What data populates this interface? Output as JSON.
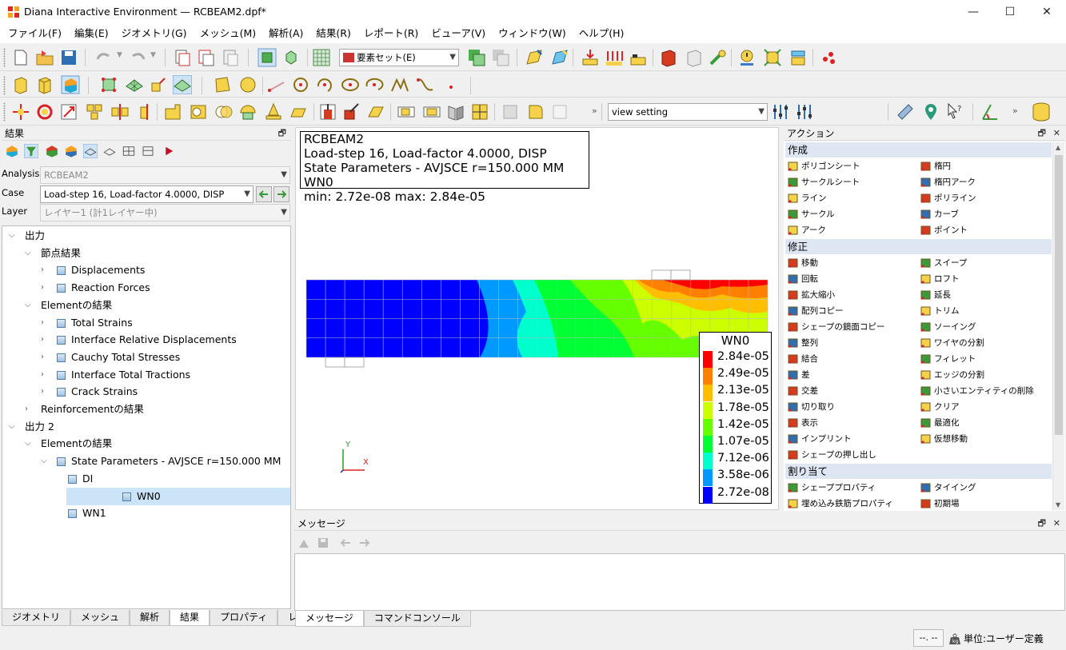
{
  "window": {
    "title": "Diana Interactive Environment — RCBEAM2.dpf*",
    "minimize": "—",
    "maximize": "☐",
    "close": "✕"
  },
  "menu": [
    "ファイル(F)",
    "編集(E)",
    "ジオメトリ(G)",
    "メッシュ(M)",
    "解析(A)",
    "結果(R)",
    "レポート(R)",
    "ビューア(V)",
    "ウィンドウ(W)",
    "ヘルプ(H)"
  ],
  "toolbar": {
    "element_set": "要素セット(E)",
    "view_setting": "view setting",
    "overflow": "»"
  },
  "results_panel": {
    "title": "結果",
    "analysis_label": "Analysis",
    "analysis_value": "RCBEAM2",
    "case_label": "Case",
    "case_value": "Load-step 16, Load-factor 4.0000, DISP",
    "layer_label": "Layer",
    "layer_value": "レイヤー1 (計1レイヤー中)"
  },
  "tree": [
    {
      "label": "出力",
      "level": 0,
      "expanded": true,
      "icon": false
    },
    {
      "label": "節点結果",
      "level": 1,
      "expanded": true,
      "icon": false
    },
    {
      "label": "Displacements",
      "level": 2,
      "expanded": false,
      "icon": true
    },
    {
      "label": "Reaction Forces",
      "level": 2,
      "expanded": false,
      "icon": true
    },
    {
      "label": "Elementの結果",
      "level": 1,
      "expanded": true,
      "icon": false
    },
    {
      "label": "Total Strains",
      "level": 2,
      "expanded": false,
      "icon": true
    },
    {
      "label": "Interface Relative Displacements",
      "level": 2,
      "expanded": false,
      "icon": true
    },
    {
      "label": "Cauchy Total Stresses",
      "level": 2,
      "expanded": false,
      "icon": true
    },
    {
      "label": "Interface Total Tractions",
      "level": 2,
      "expanded": false,
      "icon": true
    },
    {
      "label": "Crack Strains",
      "level": 2,
      "expanded": false,
      "icon": true
    },
    {
      "label": "Reinforcementの結果",
      "level": 1,
      "expanded": false,
      "icon": false
    },
    {
      "label": "出力 2",
      "level": 0,
      "expanded": true,
      "icon": false
    },
    {
      "label": "Elementの結果",
      "level": 1,
      "expanded": true,
      "icon": false
    },
    {
      "label": "State Parameters - AVJSCE r=150.000 MM",
      "level": 2,
      "expanded": true,
      "icon": true
    },
    {
      "label": "DI",
      "level": 3,
      "leaf": true,
      "icon": true
    },
    {
      "label": "WN0",
      "level": 3,
      "leaf": true,
      "icon": true,
      "selected": true
    },
    {
      "label": "WN1",
      "level": 3,
      "leaf": true,
      "icon": true
    }
  ],
  "left_tabs": [
    "ジオメトリ",
    "メッシュ",
    "解析",
    "結果",
    "プロパティ",
    "レポート"
  ],
  "left_tab_active": "結果",
  "viewport": {
    "info_lines": [
      "RCBEAM2",
      "Load-step 16, Load-factor 4.0000, DISP",
      "State Parameters - AVJSCE r=150.000 MM WN0",
      "min: 2.72e-08 max: 2.84e-05"
    ],
    "legend_title": "WN0",
    "legend_values": [
      "2.84e-05",
      "2.49e-05",
      "2.13e-05",
      "1.78e-05",
      "1.42e-05",
      "1.07e-05",
      "7.12e-06",
      "3.58e-06",
      "2.72e-08"
    ],
    "legend_colors": [
      "#ff0000",
      "#ff7f00",
      "#ffbf00",
      "#ccff00",
      "#66ff00",
      "#00ff33",
      "#00ffcc",
      "#0099ff",
      "#0000ff"
    ],
    "axis_y": "Y",
    "axis_x": "X"
  },
  "actions": {
    "title": "アクション",
    "sections": [
      {
        "title": "作成",
        "items": [
          "ポリゴンシート",
          "楕円",
          "サークルシート",
          "楕円アーク",
          "ライン",
          "ポリライン",
          "サークル",
          "カーブ",
          "アーク",
          "ポイント"
        ]
      },
      {
        "title": "修正",
        "items": [
          "移動",
          "スイープ",
          "回転",
          "ロフト",
          "拡大縮小",
          "延長",
          "配列コピー",
          "トリム",
          "シェープの鏡面コピー",
          "ソーイング",
          "整列",
          "ワイヤの分割",
          "結合",
          "フィレット",
          "差",
          "エッジの分割",
          "交差",
          "小さいエンティティの削除",
          "切り取り",
          "クリア",
          "表示",
          "最適化",
          "インプリント",
          "仮想移動",
          "シェープの押し出し"
        ]
      },
      {
        "title": "割り当て",
        "items": [
          "シェーププロパティ",
          "タイイング",
          "埋め込み鉄筋プロパティ",
          "初期場"
        ]
      }
    ]
  },
  "messages": {
    "title": "メッセージ",
    "tabs": [
      "メッセージ",
      "コマンドコンソール"
    ],
    "tab_active": "メッセージ"
  },
  "status": {
    "coords": "--. --",
    "units": "単位:ユーザー定義"
  }
}
